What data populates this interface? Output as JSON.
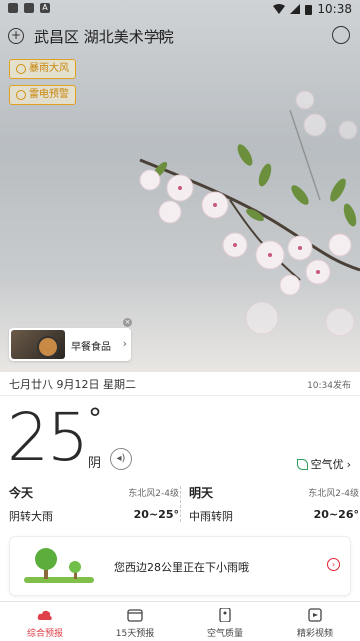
{
  "status_bar": {
    "time": "10:38"
  },
  "location": {
    "name": "武昌区 湖北美术学院"
  },
  "alerts": [
    "暴雨大风",
    "雷电预警"
  ],
  "ad": {
    "label": "早餐食品"
  },
  "panel": {
    "date": "七月廿八  9月12日 星期二",
    "published": "10:34发布",
    "temperature": "25",
    "degree": "°",
    "condition": "阴",
    "air_quality": "空气优",
    "today": {
      "title": "今天",
      "wind": "东北风2-4级",
      "condition": "阴转大雨",
      "range": "20~25°"
    },
    "tomorrow": {
      "title": "明天",
      "wind": "东北风2-4级",
      "condition": "中雨转阴",
      "range": "20~26°"
    },
    "rain_notice": "您西边28公里正在下小雨哦"
  },
  "nav": [
    {
      "label": "综合预报",
      "icon": "cloud-icon",
      "active": true
    },
    {
      "label": "15天预报",
      "icon": "calendar-icon",
      "active": false
    },
    {
      "label": "空气质量",
      "icon": "air-quality-icon",
      "active": false
    },
    {
      "label": "精彩视频",
      "icon": "video-icon",
      "active": false
    }
  ],
  "colors": {
    "accent": "#e0404a",
    "alert": "#e0a020",
    "good_air": "#2fa05a"
  }
}
